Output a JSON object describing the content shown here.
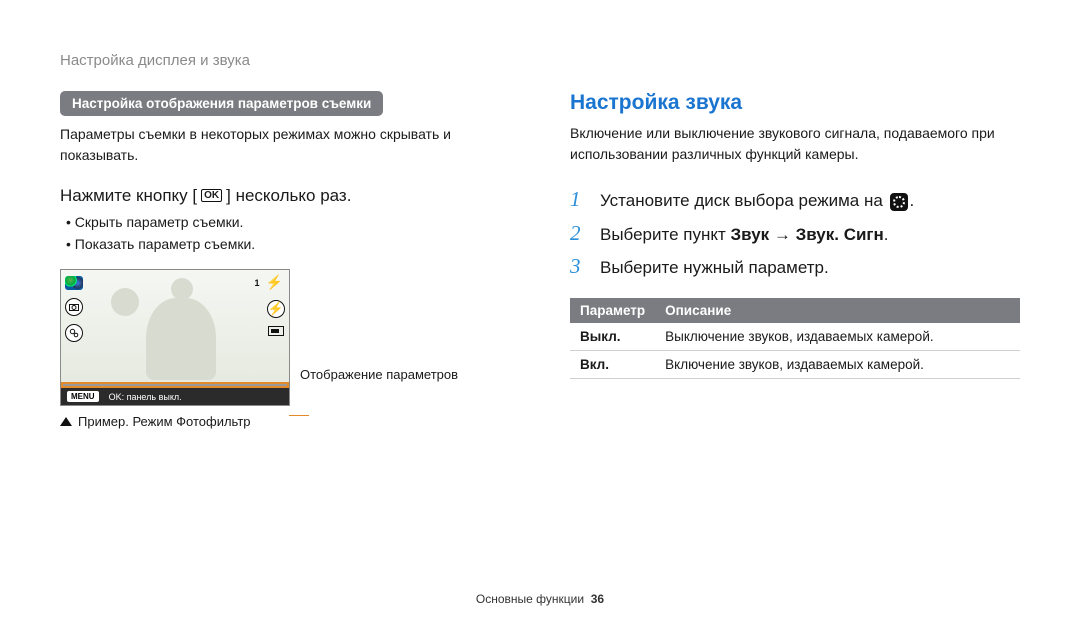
{
  "page_header": "Настройка дисплея и звука",
  "left": {
    "section_title": "Настройка отображения параметров съемки",
    "section_body": "Параметры съемки в некоторых режимах можно скрывать и показывать.",
    "instr_pre": "Нажмите кнопку [",
    "instr_key": "OK",
    "instr_post": "] несколько раз.",
    "bullets": {
      "b0": "Скрыть параметр съемки.",
      "b1": "Показать параметр съемки."
    },
    "lcd": {
      "top_count": "1",
      "menu": "MENU",
      "menu_text": "OK: панель выкл."
    },
    "callout": "Отображение параметров",
    "caption": "Пример. Режим Фотофильтр"
  },
  "right": {
    "heading": "Настройка звука",
    "body": "Включение или выключение звукового сигнала, подаваемого при использовании различных функций камеры.",
    "steps": {
      "s1_pre": "Установите диск выбора режима на ",
      "s1_post": ".",
      "s2_pre": "Выберите пункт ",
      "s2_b1": "Звук",
      "s2_arrow": " → ",
      "s2_b2": "Звук. Сигн",
      "s2_post": ".",
      "s3": "Выберите нужный параметр."
    },
    "table": {
      "h1": "Параметр",
      "h2": "Описание",
      "r1c1": "Выкл.",
      "r1c2": "Выключение звуков, издаваемых камерой.",
      "r2c1": "Вкл.",
      "r2c2": "Включение звуков, издаваемых камерой."
    }
  },
  "footer": {
    "label": "Основные функции",
    "page": "36"
  }
}
